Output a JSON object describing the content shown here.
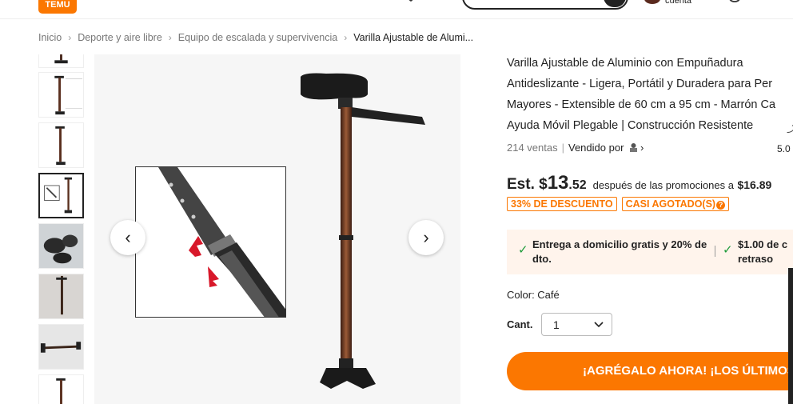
{
  "header": {
    "logo_text": "TEMU",
    "account_label": "cuenta",
    "accent_color": "#fb7701"
  },
  "breadcrumb": {
    "items": [
      "Inicio",
      "Deporte y aire libre",
      "Equipo de escalada y supervivencia"
    ],
    "current": "Varilla Ajustable de Alumi..."
  },
  "gallery": {
    "prev_icon": "chevron-left-icon",
    "next_icon": "chevron-right-icon",
    "prev_glyph": "‹",
    "next_glyph": "›",
    "selected_index": 3
  },
  "product": {
    "title_lines": [
      "Varilla Ajustable de Aluminio con Empuñadura",
      "Antideslizante - Ligera, Portátil y Duradera para Per",
      "Mayores - Extensible de 60 cm a 95 cm - Marrón Ca",
      "Ayuda Móvil Plegable | Construcción Resistente"
    ],
    "sold": "214 ventas",
    "sold_by": "Vendido por",
    "rating": "5.0"
  },
  "price": {
    "prefix": "Est. $",
    "whole": "13",
    "cents": ".52",
    "after_text": "después de las promociones a",
    "original": "$16.89"
  },
  "badges": {
    "discount": "33% DE DESCUENTO",
    "almost_sold_out": "CASI AGOTADO(S)"
  },
  "delivery": {
    "item1": "Entrega a domicilio gratis y 20% de dto.",
    "item2": "$1.00 de c retraso"
  },
  "options": {
    "color_label": "Color: Café",
    "qty_label": "Cant.",
    "qty_value": "1"
  },
  "cta": {
    "add_label": "¡AGRÉGALO AHORA! ¡LOS ÚLTIMOS"
  }
}
